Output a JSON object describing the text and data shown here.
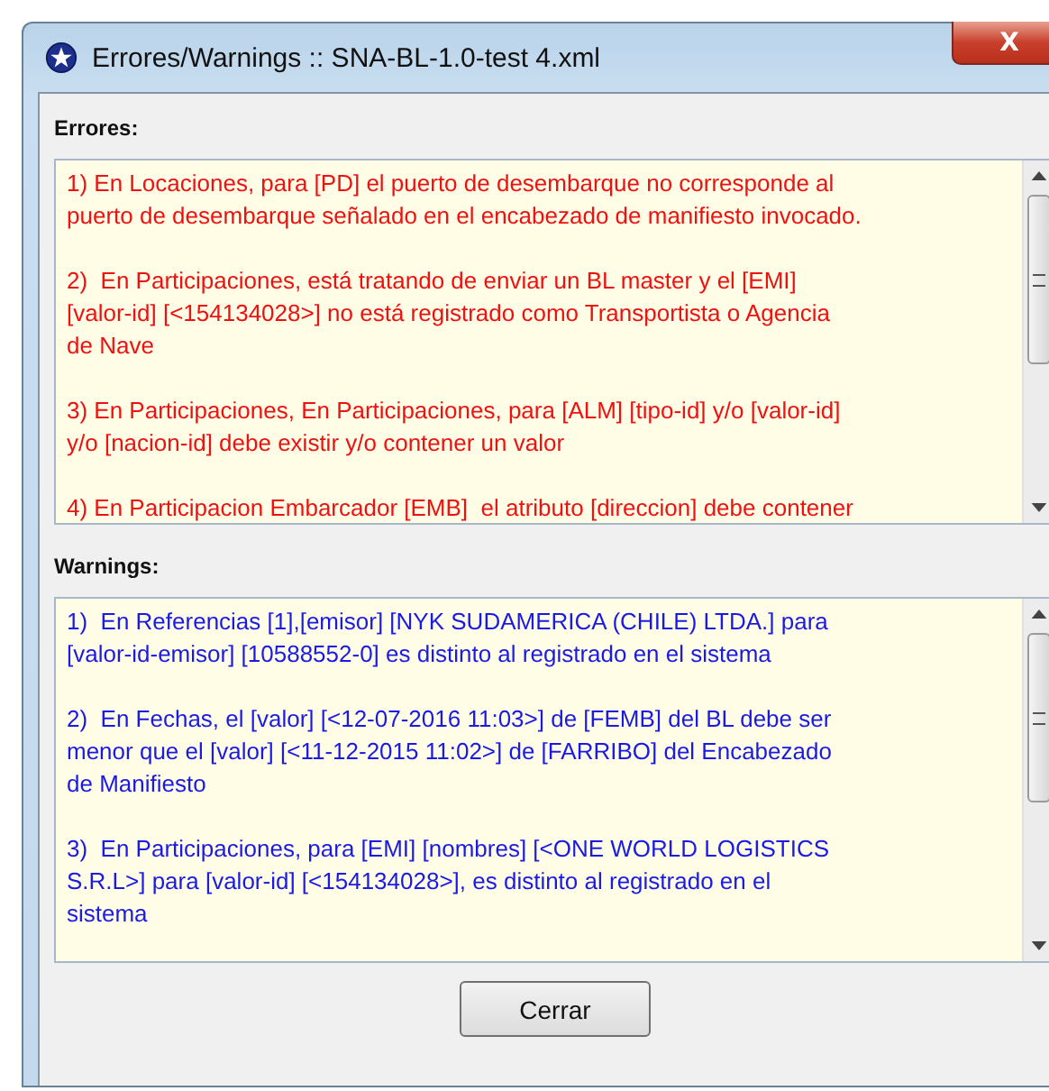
{
  "window": {
    "title": "Errores/Warnings :: SNA-BL-1.0-test 4.xml",
    "close": "X"
  },
  "sections": [
    {
      "label": "Errores:",
      "kind": "error",
      "messages": [
        "1) En Locaciones, para [PD] el puerto de desembarque no corresponde al\npuerto de desembarque señalado en el encabezado de manifiesto invocado.",
        "2)  En Participaciones, está tratando de enviar un BL master y el [EMI]\n[valor-id] [<154134028>] no está registrado como Transportista o Agencia\nde Nave",
        "3) En Participaciones, En Participaciones, para [ALM] [tipo-id] y/o [valor-id]\ny/o [nacion-id] debe existir y/o contener un valor",
        "4) En Participacion Embarcador [EMB]  el atributo [direccion] debe contener"
      ]
    },
    {
      "label": "Warnings:",
      "kind": "warning",
      "messages": [
        "1)  En Referencias [1],[emisor] [NYK SUDAMERICA (CHILE) LTDA.] para\n[valor-id-emisor] [10588552-0] es distinto al registrado en el sistema",
        "2)  En Fechas, el [valor] [<12-07-2016 11:03>] de [FEMB] del BL debe ser\nmenor que el [valor] [<11-12-2015 11:02>] de [FARRIBO] del Encabezado\nde Manifiesto",
        "3)  En Participaciones, para [EMI] [nombres] [<ONE WORLD LOGISTICS\nS.R.L>] para [valor-id] [<154134028>], es distinto al registrado en el\nsistema"
      ]
    }
  ],
  "buttons": [
    "Cerrar"
  ]
}
